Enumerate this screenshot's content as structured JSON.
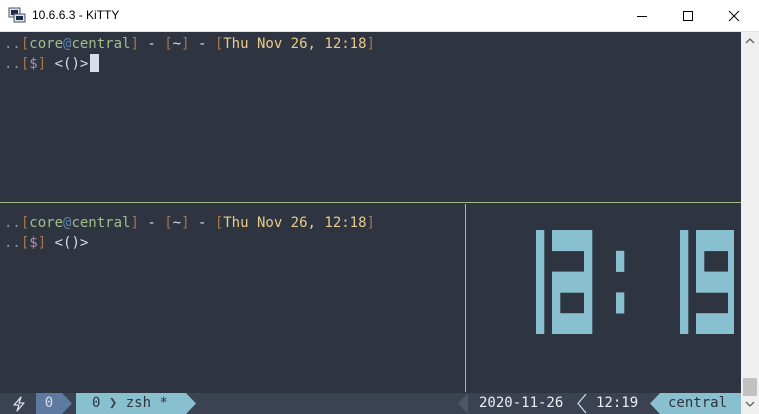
{
  "window": {
    "title": "10.6.6.3 - KiTTY"
  },
  "colors": {
    "background": "#2e3440",
    "accent": "#88c0d0",
    "prompt_user": "#a3be8c",
    "prompt_date": "#ebcb8b",
    "prompt_dollar": "#b48ead"
  },
  "top_pane": {
    "prompt1": {
      "dots": "..",
      "lbracket": "[",
      "user": "core",
      "at": "@",
      "host": "central",
      "rbracket": "]",
      "sep1": " - ",
      "dir_lb": "[",
      "dir": "~",
      "dir_rb": "]",
      "sep2": " - ",
      "date_lb": "[",
      "date": "Thu Nov 26, 12:18",
      "date_rb": "]"
    },
    "prompt2": {
      "dots": "..",
      "lb": "[",
      "dollar": "$",
      "rb": "]",
      "arrows": " <()>"
    }
  },
  "bottom_pane": {
    "prompt1": {
      "dots": "..",
      "lbracket": "[",
      "user": "core",
      "at": "@",
      "host": "central",
      "rbracket": "]",
      "sep1": " - ",
      "dir_lb": "[",
      "dir": "~",
      "dir_rb": "]",
      "sep2": " - ",
      "date_lb": "[",
      "date": "Thu Nov 26, 12:18",
      "date_rb": "]"
    },
    "prompt2": {
      "dots": "..",
      "lb": "[",
      "dollar": "$",
      "rb": "]",
      "arrows": " <()>"
    },
    "clock": {
      "time": "12:19",
      "color": "#88c0d0"
    }
  },
  "status_bar": {
    "bolt_icon": "bolt-icon",
    "session": "0",
    "window_index": "0",
    "window_name": "zsh *",
    "date": "2020-11-26",
    "time": "12:19",
    "host": "central"
  },
  "icons": {
    "app": "putty-terminal-icon",
    "minimize": "minimize-icon",
    "maximize": "maximize-icon",
    "close": "close-icon",
    "scroll_up": "scroll-up-arrow-icon",
    "scroll_down": "scroll-down-arrow-icon"
  }
}
